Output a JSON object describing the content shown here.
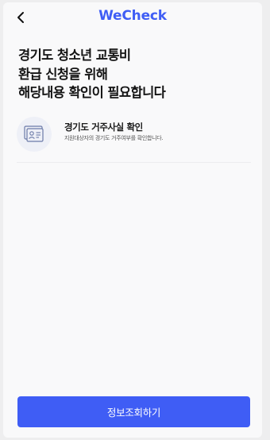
{
  "header": {
    "back_icon": "chevron-left-icon",
    "title": "WeCheck"
  },
  "heading": {
    "lines": [
      "경기도 청소년 교통비",
      "환급 신청을 위해",
      "해당내용 확인이 필요합니다"
    ]
  },
  "check_item": {
    "icon": "resident-card-icon",
    "title": "경기도 거주사실 확인",
    "description": "지원대상자의 경기도 거주여부를 확인합니다."
  },
  "footer": {
    "primary_button_label": "정보조회하기"
  },
  "colors": {
    "brand": "#3f5df5",
    "background": "#f9f9fa",
    "text": "#141414"
  }
}
